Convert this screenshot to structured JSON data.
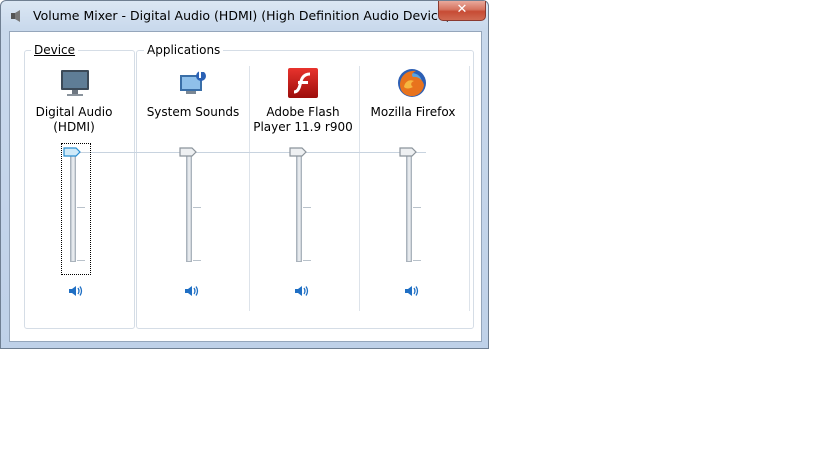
{
  "window": {
    "title": "Volume Mixer - Digital Audio (HDMI) (High Definition Audio Device)",
    "close_label": "✕",
    "accent_color": "#0a7cd6"
  },
  "device_group": {
    "label": "Device",
    "device_name_line1": "Digital Audio",
    "device_name_line2": "(HDMI)",
    "icon": "monitor-icon",
    "volume": 100
  },
  "applications_group": {
    "label": "Applications",
    "apps": [
      {
        "label_line1": "System Sounds",
        "label_line2": "",
        "icon": "system-sounds-icon",
        "volume": 100
      },
      {
        "label_line1": "Adobe Flash",
        "label_line2": "Player 11.9 r900",
        "icon": "flash-icon",
        "volume": 100
      },
      {
        "label_line1": "Mozilla Firefox",
        "label_line2": "",
        "icon": "firefox-icon",
        "volume": 100
      }
    ]
  }
}
